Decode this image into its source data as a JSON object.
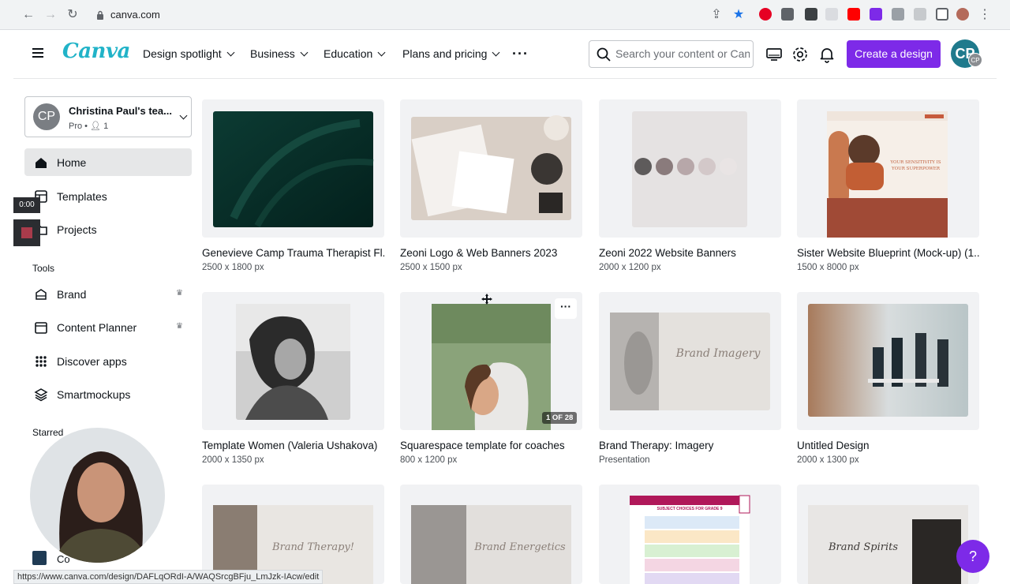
{
  "browser": {
    "url": "canva.com",
    "status_url": "https://www.canva.com/design/DAFLqORdI-A/WAQSrcgBFju_LmJzk-IAcw/edit"
  },
  "header": {
    "logo": "Canva",
    "nav": [
      "Design spotlight",
      "Business",
      "Education",
      "Plans and pricing"
    ],
    "search_placeholder": "Search your content or Canva",
    "create_label": "Create a design",
    "avatar_initials": "CP",
    "avatar_mini_initials": "CP"
  },
  "sidebar": {
    "team_initials": "CP",
    "team_name": "Christina Paul's tea...",
    "team_plan": "Pro",
    "team_members": "1",
    "items": [
      "Home",
      "Templates",
      "Projects"
    ],
    "tools_label": "Tools",
    "tools": [
      "Brand",
      "Content Planner",
      "Discover apps",
      "Smartmockups"
    ],
    "starred_label": "Starred",
    "starred_partial": "Co"
  },
  "designs": [
    {
      "title": "Genevieve Camp Trauma Therapist Fl...",
      "sub": "2500 x 1800 px"
    },
    {
      "title": "Zeoni Logo & Web Banners 2023",
      "sub": "2500 x 1500 px"
    },
    {
      "title": "Zeoni 2022 Website Banners",
      "sub": "2000 x 1200 px"
    },
    {
      "title": "Sister Website Blueprint (Mock-up) (1...",
      "sub": "1500 x 8000 px"
    },
    {
      "title": "Template Women (Valeria Ushakova)",
      "sub": "2000 x 1350 px"
    },
    {
      "title": "Squarespace template for coaches",
      "sub": "800 x 1200 px",
      "pager": "1 OF 28"
    },
    {
      "title": "Brand Therapy: Imagery",
      "sub": "Presentation"
    },
    {
      "title": "Untitled Design",
      "sub": "2000 x 1300 px"
    }
  ],
  "thumb_text": {
    "sister_head": "YOUR SENSITIVITY IS YOUR SUPERPOWER",
    "brand_imagery": "Brand Imagery",
    "brand_therapy": "Brand Therapy!",
    "brand_energetics": "Brand Energetics",
    "brand_spirits": "Brand Spirits",
    "school_head": "SUBJECT CHOICES FOR GRADE 9"
  },
  "overlay": {
    "timer": "0:00",
    "help": "?"
  }
}
